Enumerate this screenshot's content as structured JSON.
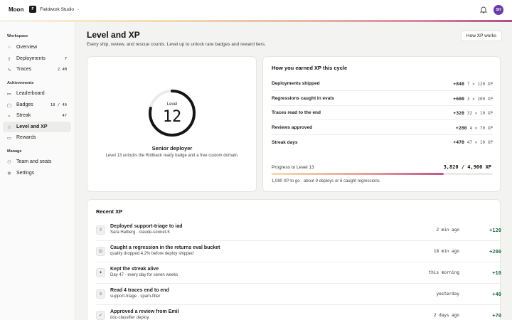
{
  "app": {
    "name": "Moon",
    "workspace_badge": "F",
    "workspace_name": "Fieldwork Studio",
    "avatar_initials": "SH"
  },
  "colors": {
    "accent_gradient": [
      "#f3ddb0",
      "#e9a99a",
      "#c0558c"
    ],
    "xp_green": "#1f6b3a",
    "avatar": "#6a3aa8"
  },
  "sidebar": {
    "workspace_label": "Workspace",
    "workspace_items": [
      {
        "label": "Overview",
        "icon": "circle-icon",
        "count": ""
      },
      {
        "label": "Deployments",
        "icon": "rocket-icon",
        "count": "7"
      },
      {
        "label": "Traces",
        "icon": "wave-icon",
        "count": "2.4M"
      }
    ],
    "achievements_label": "Achievements",
    "achievement_items": [
      {
        "label": "Leaderboard",
        "icon": "list-icon",
        "count": ""
      },
      {
        "label": "Badges",
        "icon": "badge-icon",
        "count": "18 / 40"
      },
      {
        "label": "Streak",
        "icon": "flame-icon",
        "count": "47"
      },
      {
        "label": "Level and XP",
        "icon": "star-icon",
        "count": ""
      },
      {
        "label": "Rewards",
        "icon": "gift-icon",
        "count": ""
      }
    ],
    "manage_label": "Manage",
    "manage_items": [
      {
        "label": "Team and seats",
        "icon": "people-icon",
        "count": ""
      },
      {
        "label": "Settings",
        "icon": "gear-icon",
        "count": ""
      }
    ]
  },
  "page": {
    "title": "Level and XP",
    "subtitle": "Every ship, review, and rescue counts. Level up to unlock rare badges and reward tiers.",
    "how_button": "How XP works"
  },
  "level": {
    "label": "Level",
    "value": "12",
    "rank": "Senior deployer",
    "unlock": "Level 13 unlocks the Rollback ready badge and a free custom domain.",
    "progress_fraction": 0.7843
  },
  "earned": {
    "title": "How you earned XP this cycle",
    "rows": [
      {
        "name": "Deployments shipped",
        "xp": "+840",
        "calc": "7 × 120 XP"
      },
      {
        "name": "Regressions caught in evals",
        "xp": "+600",
        "calc": "3 × 200 XP"
      },
      {
        "name": "Traces read to the end",
        "xp": "+320",
        "calc": "32 × 10 XP"
      },
      {
        "name": "Reviews approved",
        "xp": "+280",
        "calc": "4 × 70 XP"
      },
      {
        "name": "Streak days",
        "xp": "+470",
        "calc": "47 × 10 XP"
      }
    ],
    "progress_label": "Progress to Level 13",
    "progress_value": "3,820 / 4,900 XP",
    "progress_fraction": 0.7796,
    "progress_note": "1,080 XP to go · about 9 deploys or 6 caught regressions."
  },
  "recent": {
    "title": "Recent XP",
    "rows": [
      {
        "icon": "rocket-icon",
        "glyph": "⇧",
        "title": "Deployed support-triage to iad",
        "detail": "Sara Halberg · claude-sonnet-5",
        "time": "2 min ago",
        "xp": "+120"
      },
      {
        "icon": "eval-icon",
        "glyph": "⊡",
        "title": "Caught a regression in the returns eval bucket",
        "detail": "quality dropped 4.2% before deploy shipped",
        "time": "18 min ago",
        "xp": "+200"
      },
      {
        "icon": "flame-icon",
        "glyph": "✦",
        "title": "Kept the streak alive",
        "detail": "Day 47 · every day for seven weeks",
        "time": "this morning",
        "xp": "+10"
      },
      {
        "icon": "list-icon",
        "glyph": "≡",
        "title": "Read 4 traces end to end",
        "detail": "support-triage · spam-filter",
        "time": "yesterday",
        "xp": "+40"
      },
      {
        "icon": "check-icon",
        "glyph": "✓",
        "title": "Approved a review from Emil",
        "detail": "doc-classifier deploy",
        "time": "2 days ago",
        "xp": "+70"
      }
    ]
  }
}
